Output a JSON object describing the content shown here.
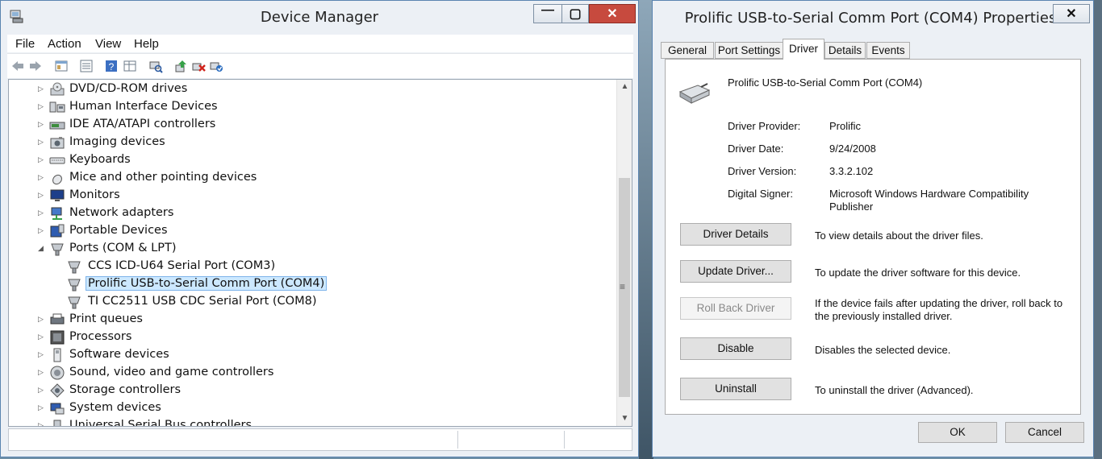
{
  "device_manager": {
    "title": "Device Manager",
    "window_controls": {
      "minimize": "—",
      "maximize": "▢",
      "close": "✕"
    },
    "menu": [
      "File",
      "Action",
      "View",
      "Help"
    ],
    "toolbar_icons": [
      "back-icon",
      "forward-icon",
      "properties-panel-icon",
      "list-view-icon",
      "help-icon",
      "details-view-icon",
      "scan-hardware-icon",
      "update-driver-icon",
      "uninstall-icon",
      "enable-device-icon"
    ],
    "tree": [
      {
        "label": "DVD/CD-ROM drives",
        "icon": "dvd-drive-icon",
        "expanded": false
      },
      {
        "label": "Human Interface Devices",
        "icon": "hid-icon",
        "expanded": false
      },
      {
        "label": "IDE ATA/ATAPI controllers",
        "icon": "ide-controller-icon",
        "expanded": false
      },
      {
        "label": "Imaging devices",
        "icon": "camera-icon",
        "expanded": false
      },
      {
        "label": "Keyboards",
        "icon": "keyboard-icon",
        "expanded": false
      },
      {
        "label": "Mice and other pointing devices",
        "icon": "mouse-icon",
        "expanded": false
      },
      {
        "label": "Monitors",
        "icon": "monitor-icon",
        "expanded": false
      },
      {
        "label": "Network adapters",
        "icon": "network-icon",
        "expanded": false
      },
      {
        "label": "Portable Devices",
        "icon": "portable-device-icon",
        "expanded": false
      },
      {
        "label": "Ports (COM & LPT)",
        "icon": "port-icon",
        "expanded": true,
        "children": [
          {
            "label": "CCS ICD-U64 Serial Port (COM3)",
            "icon": "port-icon"
          },
          {
            "label": "Prolific USB-to-Serial Comm Port (COM4)",
            "icon": "port-icon",
            "selected": true
          },
          {
            "label": "TI CC2511 USB CDC Serial Port (COM8)",
            "icon": "port-icon"
          }
        ]
      },
      {
        "label": "Print queues",
        "icon": "printer-icon",
        "expanded": false
      },
      {
        "label": "Processors",
        "icon": "processor-icon",
        "expanded": false
      },
      {
        "label": "Software devices",
        "icon": "software-device-icon",
        "expanded": false
      },
      {
        "label": "Sound, video and game controllers",
        "icon": "speaker-icon",
        "expanded": false
      },
      {
        "label": "Storage controllers",
        "icon": "storage-icon",
        "expanded": false
      },
      {
        "label": "System devices",
        "icon": "system-icon",
        "expanded": false
      },
      {
        "label": "Universal Serial Bus controllers",
        "icon": "usb-icon",
        "expanded": false
      }
    ]
  },
  "properties": {
    "title": "Prolific USB-to-Serial Comm Port (COM4) Properties",
    "close": "✕",
    "tabs": [
      "General",
      "Port Settings",
      "Driver",
      "Details",
      "Events"
    ],
    "active_tab": "Driver",
    "device_name": "Prolific USB-to-Serial Comm Port (COM4)",
    "fields": [
      {
        "label": "Driver Provider:",
        "value": "Prolific"
      },
      {
        "label": "Driver Date:",
        "value": "9/24/2008"
      },
      {
        "label": "Driver Version:",
        "value": "3.3.2.102"
      },
      {
        "label": "Digital Signer:",
        "value": "Microsoft Windows Hardware Compatibility Publisher"
      }
    ],
    "actions": [
      {
        "button": "Driver Details",
        "description": "To view details about the driver files.",
        "enabled": true
      },
      {
        "button": "Update Driver...",
        "description": "To update the driver software for this device.",
        "enabled": true
      },
      {
        "button": "Roll Back Driver",
        "description": "If the device fails after updating the driver, roll back to the previously installed driver.",
        "enabled": false
      },
      {
        "button": "Disable",
        "description": "Disables the selected device.",
        "enabled": true
      },
      {
        "button": "Uninstall",
        "description": "To uninstall the driver (Advanced).",
        "enabled": true
      }
    ],
    "ok_label": "OK",
    "cancel_label": "Cancel"
  }
}
